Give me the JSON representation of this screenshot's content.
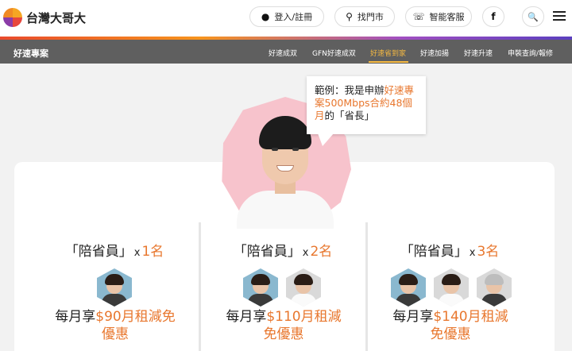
{
  "header": {
    "brand": "台灣大哥大",
    "login_label": "登入/註冊",
    "store_label": "找門市",
    "service_label": "智能客服",
    "facebook_glyph": "f",
    "icons": [
      "user-icon",
      "location-pin-icon",
      "headset-icon",
      "facebook-icon",
      "search-icon",
      "menu-icon"
    ]
  },
  "subnav": {
    "title": "好速專案",
    "items": [
      {
        "label": "好速成双",
        "active": false
      },
      {
        "label": "GFN好速成双",
        "active": false
      },
      {
        "label": "好速省到家",
        "active": true
      },
      {
        "label": "好速加揚",
        "active": false
      },
      {
        "label": "好速升速",
        "active": false
      },
      {
        "label": "申裝查詢/報修",
        "active": false
      }
    ],
    "active_color": "#f5b942"
  },
  "bubble": {
    "prefix": "範例：我是申辦",
    "highlight": "好速專案500Mbps合約48個月",
    "suffix": "的「省長」"
  },
  "plans": [
    {
      "title": "「陪省員」",
      "times": "x",
      "count": "1名",
      "offer_prefix": "每月享",
      "offer_highlight": "$90月租減免",
      "offer_suffix": "優惠"
    },
    {
      "title": "「陪省員」",
      "times": "x",
      "count": "2名",
      "offer_prefix": "每月享",
      "offer_highlight": "$110月租減",
      "offer_suffix": "免優惠"
    },
    {
      "title": "「陪省員」",
      "times": "x",
      "count": "3名",
      "offer_prefix": "每月享",
      "offer_highlight": "$140月租減",
      "offer_suffix": "免優惠"
    }
  ],
  "colors": {
    "accent": "#e8772e",
    "avatar_bg": "#f7c3cc",
    "subnav_bg": "#5f5f5f"
  }
}
